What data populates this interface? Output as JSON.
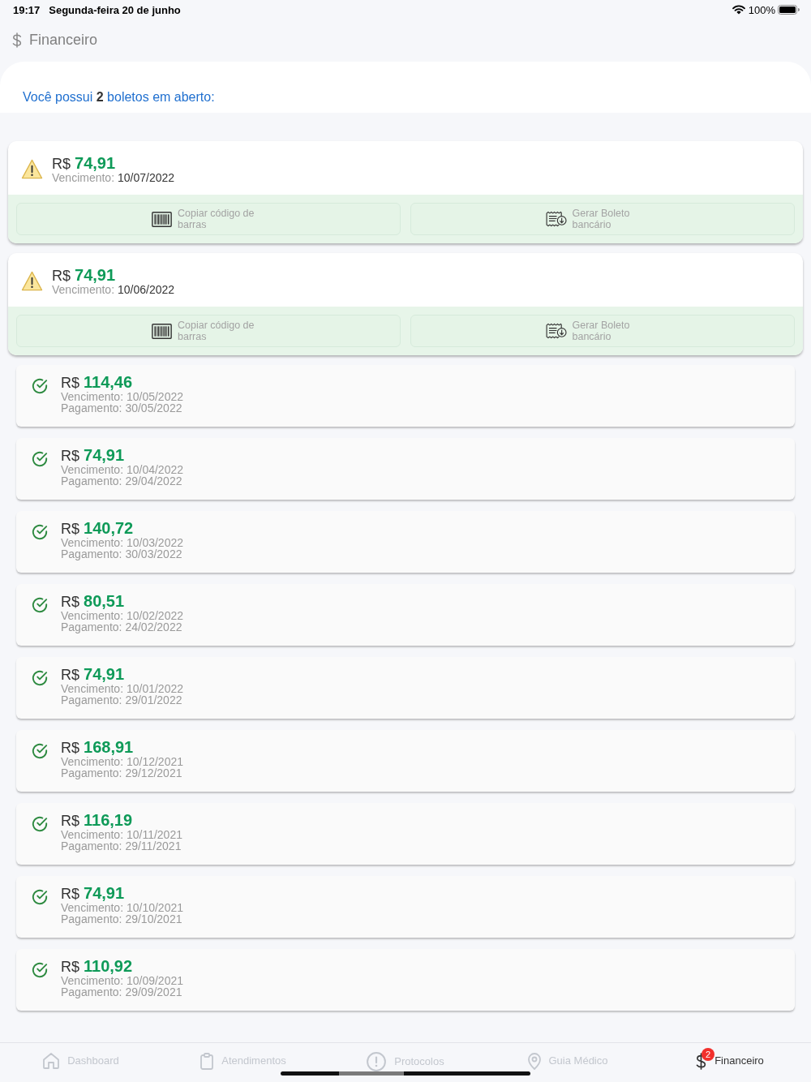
{
  "status_bar": {
    "time": "19:17",
    "date": "Segunda-feira 20 de junho",
    "battery": "100%"
  },
  "header": {
    "title": "Financeiro"
  },
  "summary": "Você possui **2** boletos em aberto:",
  "bills": [
    {
      "kind": "open",
      "currency": "R$",
      "amount": "74,91",
      "due_label": "Vencimento:",
      "due_date": "10/07/2022",
      "actions": [
        {
          "kind": "barcode",
          "label": "Copiar código de barras"
        },
        {
          "kind": "boleto",
          "label": "Gerar Boleto bancário"
        }
      ]
    },
    {
      "kind": "open",
      "currency": "R$",
      "amount": "74,91",
      "due_label": "Vencimento:",
      "due_date": "10/06/2022",
      "actions": [
        {
          "kind": "barcode",
          "label": "Copiar código de barras"
        },
        {
          "kind": "boleto",
          "label": "Gerar Boleto bancário"
        }
      ]
    },
    {
      "kind": "paid",
      "currency": "R$",
      "amount": "114,46",
      "due_label": "Vencimento:",
      "due_date": "10/05/2022",
      "payment_label": "Pagamento:",
      "payment_date": "30/05/2022"
    },
    {
      "kind": "paid",
      "currency": "R$",
      "amount": "74,91",
      "due_label": "Vencimento:",
      "due_date": "10/04/2022",
      "payment_label": "Pagamento:",
      "payment_date": "29/04/2022"
    },
    {
      "kind": "paid",
      "currency": "R$",
      "amount": "140,72",
      "due_label": "Vencimento:",
      "due_date": "10/03/2022",
      "payment_label": "Pagamento:",
      "payment_date": "30/03/2022"
    },
    {
      "kind": "paid",
      "currency": "R$",
      "amount": "80,51",
      "due_label": "Vencimento:",
      "due_date": "10/02/2022",
      "payment_label": "Pagamento:",
      "payment_date": "24/02/2022"
    },
    {
      "kind": "paid",
      "currency": "R$",
      "amount": "74,91",
      "due_label": "Vencimento:",
      "due_date": "10/01/2022",
      "payment_label": "Pagamento:",
      "payment_date": "29/01/2022"
    },
    {
      "kind": "paid",
      "currency": "R$",
      "amount": "168,91",
      "due_label": "Vencimento:",
      "due_date": "10/12/2021",
      "payment_label": "Pagamento:",
      "payment_date": "29/12/2021"
    },
    {
      "kind": "paid",
      "currency": "R$",
      "amount": "116,19",
      "due_label": "Vencimento:",
      "due_date": "10/11/2021",
      "payment_label": "Pagamento:",
      "payment_date": "29/11/2021"
    },
    {
      "kind": "paid",
      "currency": "R$",
      "amount": "74,91",
      "due_label": "Vencimento:",
      "due_date": "10/10/2021",
      "payment_label": "Pagamento:",
      "payment_date": "29/10/2021"
    },
    {
      "kind": "paid",
      "currency": "R$",
      "amount": "110,92",
      "due_label": "Vencimento:",
      "due_date": "10/09/2021",
      "payment_label": "Pagamento:",
      "payment_date": "29/09/2021"
    }
  ],
  "tab_bar": {
    "tabs": [
      {
        "label": "Dashboard",
        "kind": "home",
        "selected": false
      },
      {
        "label": "Atendimentos",
        "kind": "clipboard",
        "selected": false
      },
      {
        "label": "Protocolos",
        "kind": "alert",
        "selected": false
      },
      {
        "label": "Guia Médico",
        "kind": "pin",
        "selected": false
      },
      {
        "label": "Financeiro",
        "kind": "dollar",
        "selected": true,
        "badge": "2"
      }
    ]
  }
}
